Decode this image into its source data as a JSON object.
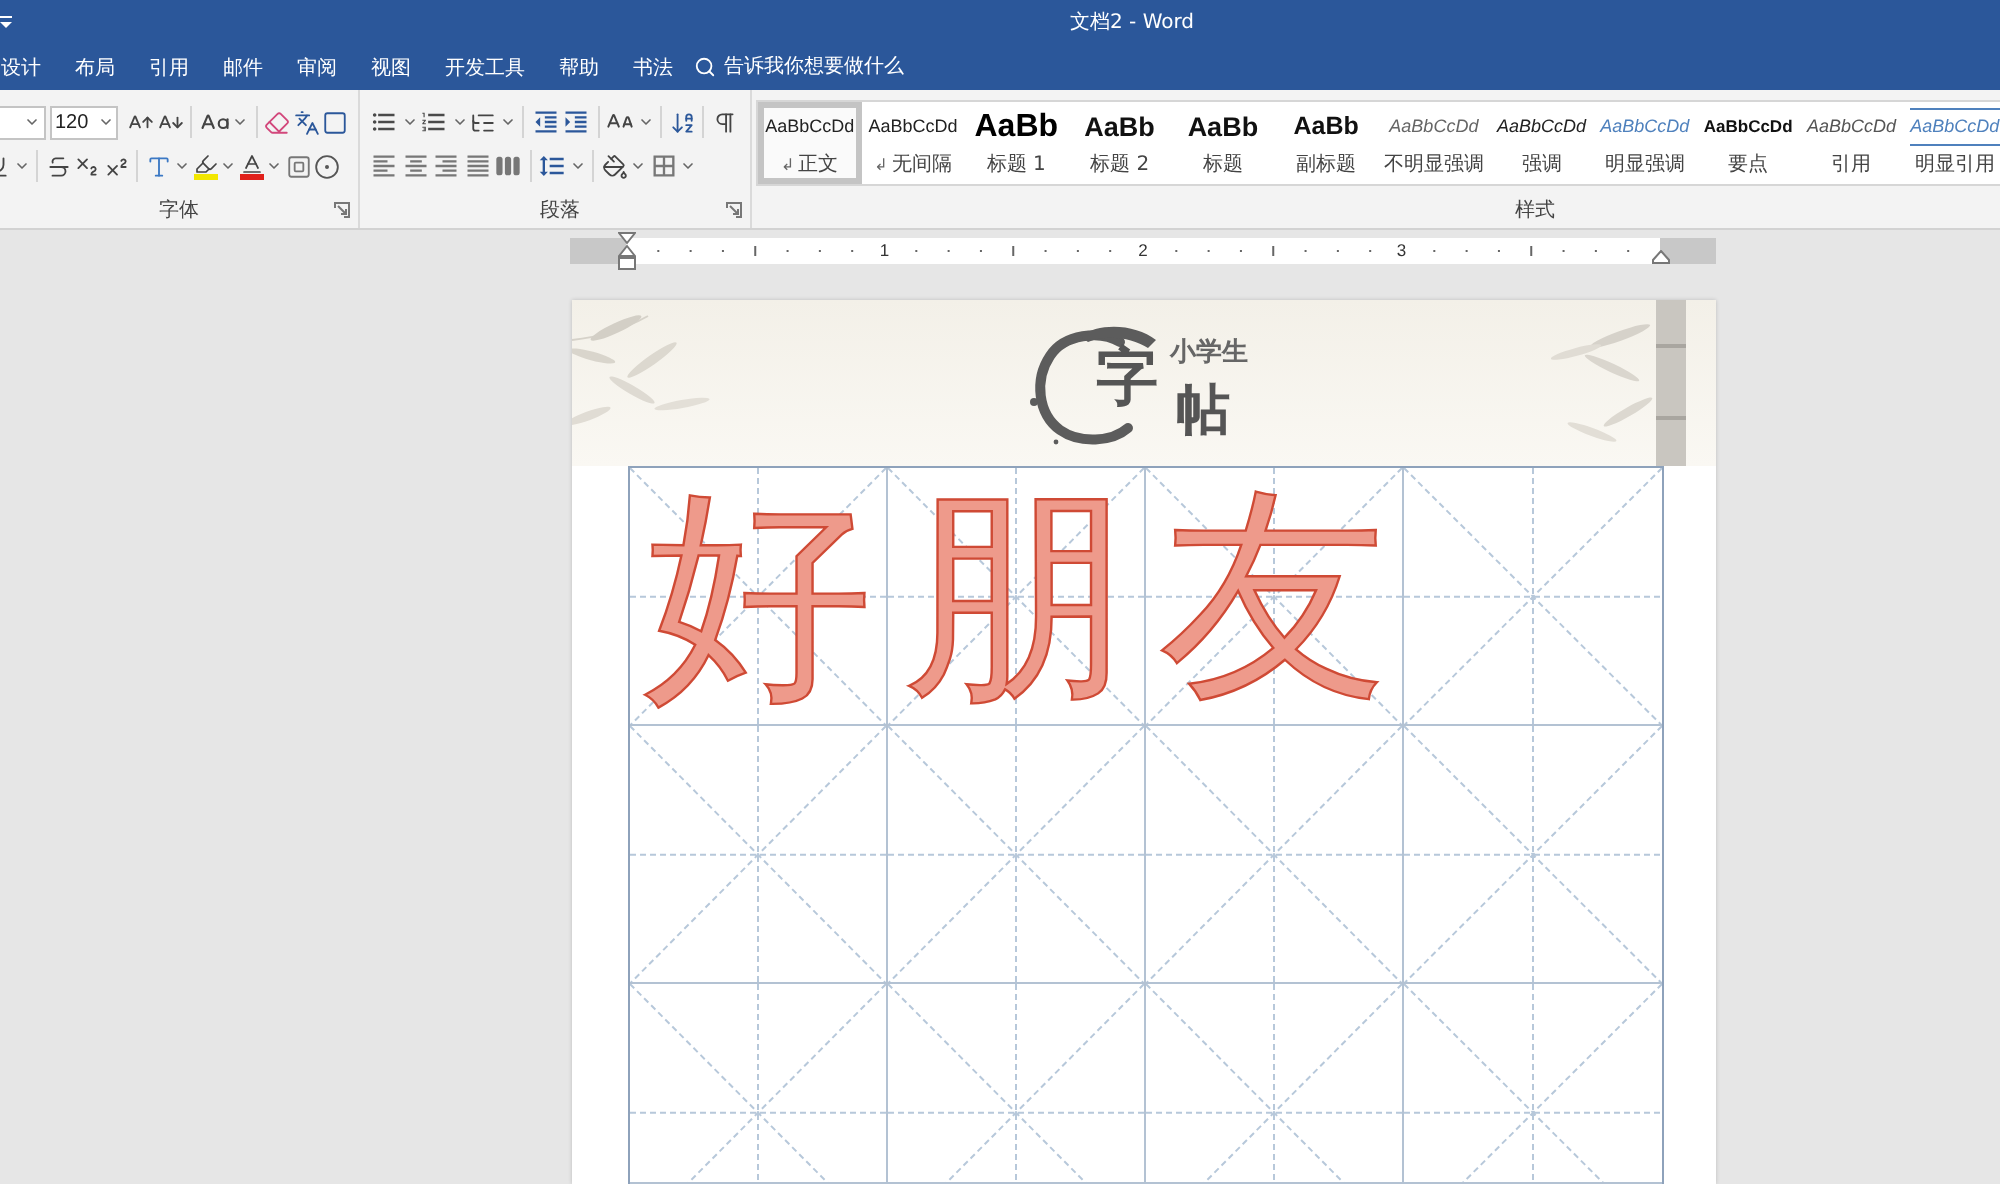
{
  "window": {
    "title": "文档2 - Word"
  },
  "tabs": [
    {
      "label": "设计",
      "selected": false
    },
    {
      "label": "布局",
      "selected": false
    },
    {
      "label": "引用",
      "selected": false
    },
    {
      "label": "邮件",
      "selected": false
    },
    {
      "label": "审阅",
      "selected": false
    },
    {
      "label": "视图",
      "selected": false
    },
    {
      "label": "开发工具",
      "selected": false
    },
    {
      "label": "帮助",
      "selected": false
    },
    {
      "label": "书法",
      "selected": false
    }
  ],
  "tell_me": {
    "placeholder": "告诉我你想要做什么"
  },
  "ribbon": {
    "font": {
      "label": "字体",
      "font_size": "120"
    },
    "paragraph": {
      "label": "段落"
    },
    "styles": {
      "label": "样式",
      "items": [
        {
          "kind": "normal",
          "preview": "AaBbCcDd",
          "mark": "↲",
          "name": "正文",
          "selected": true
        },
        {
          "kind": "normal",
          "preview": "AaBbCcDd",
          "mark": "↲",
          "name": "无间隔",
          "selected": false
        },
        {
          "kind": "heading1",
          "preview": "AaBb",
          "name": "标题 1",
          "selected": false
        },
        {
          "kind": "heading2",
          "preview": "AaBb",
          "name": "标题 2",
          "selected": false
        },
        {
          "kind": "title",
          "preview": "AaBb",
          "name": "标题",
          "selected": false
        },
        {
          "kind": "subtitle",
          "preview": "AaBb",
          "name": "副标题",
          "selected": false
        },
        {
          "kind": "subtle",
          "preview": "AaBbCcDd",
          "name": "不明显强调",
          "selected": false
        },
        {
          "kind": "emphasis",
          "preview": "AaBbCcDd",
          "name": "强调",
          "selected": false
        },
        {
          "kind": "intense",
          "preview": "AaBbCcDd",
          "name": "明显强调",
          "selected": false
        },
        {
          "kind": "strong",
          "preview": "AaBbCcDd",
          "name": "要点",
          "selected": false
        },
        {
          "kind": "quote",
          "preview": "AaBbCcDd",
          "name": "引用",
          "selected": false
        },
        {
          "kind": "intense_quote",
          "preview": "AaBbCcDd",
          "name": "明显引用",
          "selected": false
        }
      ]
    }
  },
  "ruler": {
    "labels": [
      "1",
      "2",
      "3"
    ]
  },
  "document": {
    "header": {
      "logo_subtitle": "小学生",
      "logo_characters": [
        "字",
        "帖"
      ]
    },
    "practice_characters": [
      "好",
      "朋",
      "友"
    ]
  }
}
